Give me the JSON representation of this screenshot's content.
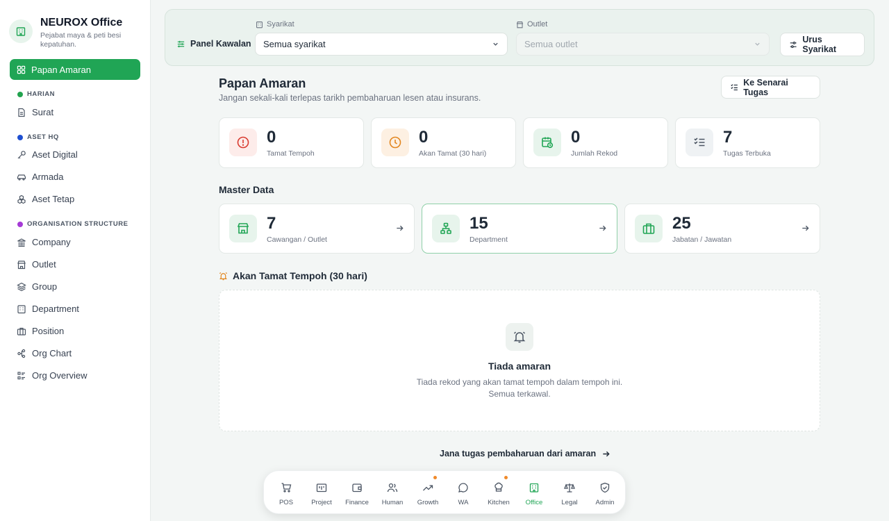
{
  "brand": {
    "title": "NEUROX Office",
    "subtitle": "Pejabat maya & peti besi kepatuhan."
  },
  "sidebar": {
    "active": "Papan Amaran",
    "sections": [
      {
        "label": "HARIAN",
        "color": "#22a34f",
        "items": [
          "Surat"
        ]
      },
      {
        "label": "ASET HQ",
        "color": "#1e4fd1",
        "items": [
          "Aset Digital",
          "Armada",
          "Aset Tetap"
        ]
      },
      {
        "label": "ORGANISATION STRUCTURE",
        "color": "#a53ad6",
        "items": [
          "Company",
          "Outlet",
          "Group",
          "Department",
          "Position",
          "Org Chart",
          "Org Overview"
        ]
      }
    ]
  },
  "panel": {
    "title": "Panel Kawalan",
    "company_label": "Syarikat",
    "company_value": "Semua syarikat",
    "outlet_label": "Outlet",
    "outlet_value": "Semua outlet",
    "manage_button": "Urus Syarikat"
  },
  "main": {
    "title": "Papan Amaran",
    "subtitle": "Jangan sekali-kali terlepas tarikh pembaharuan lesen atau insurans.",
    "tasks_button": "Ke Senarai Tugas",
    "stats": [
      {
        "value": "0",
        "label": "Tamat Tempoh"
      },
      {
        "value": "0",
        "label": "Akan Tamat (30 hari)"
      },
      {
        "value": "0",
        "label": "Jumlah Rekod"
      },
      {
        "value": "7",
        "label": "Tugas Terbuka"
      }
    ],
    "master_title": "Master Data",
    "master": [
      {
        "value": "7",
        "label": "Cawangan / Outlet"
      },
      {
        "value": "15",
        "label": "Department"
      },
      {
        "value": "25",
        "label": "Jabatan / Jawatan"
      }
    ],
    "expiring_title": "Akan Tamat Tempoh (30 hari)",
    "empty_title": "Tiada amaran",
    "empty_line1": "Tiada rekod yang akan tamat tempoh dalam tempoh ini.",
    "empty_line2": "Semua terkawal.",
    "generate_link": "Jana tugas pembaharuan dari amaran"
  },
  "dock": {
    "items": [
      "POS",
      "Project",
      "Finance",
      "Human",
      "Growth",
      "WA",
      "Kitchen",
      "Office",
      "Legal",
      "Admin"
    ],
    "active": "Office"
  },
  "colors": {
    "accent": "#20a555",
    "notification": "#f08a2a"
  }
}
